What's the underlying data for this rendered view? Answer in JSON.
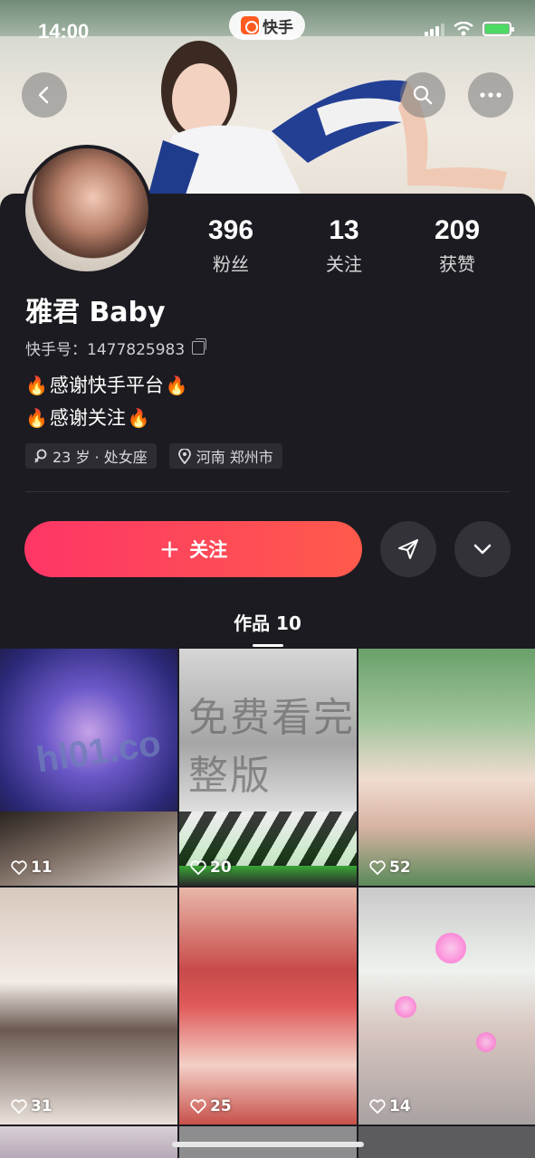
{
  "status_bar": {
    "time": "14:00",
    "app_badge_label": "快手",
    "icons": [
      "signal-icon",
      "wifi-icon",
      "battery-charging-icon"
    ]
  },
  "header": {
    "back_icon": "chevron-left-icon",
    "search_icon": "search-icon",
    "more_icon": "more-horizontal-icon"
  },
  "profile": {
    "stats": [
      {
        "value": "396",
        "label": "粉丝"
      },
      {
        "value": "13",
        "label": "关注"
      },
      {
        "value": "209",
        "label": "获赞"
      }
    ],
    "name": "雅君 Baby",
    "kuaishou_id_label": "快手号：",
    "kuaishou_id": "1477825983",
    "bio_lines": [
      "感谢快手平台",
      "感谢关注"
    ],
    "tags": [
      {
        "icon": "gender-female-icon",
        "text": "23 岁 · 处女座"
      },
      {
        "icon": "location-pin-icon",
        "text": "河南 郑州市"
      }
    ]
  },
  "actions": {
    "follow_plus": "+",
    "follow_label": "关注",
    "share_icon": "send-icon",
    "expand_icon": "chevron-down-icon"
  },
  "tabs": {
    "works_label": "作品 10"
  },
  "grid": {
    "watermark_1": "hl01.co",
    "watermark_2": "免费看完整版",
    "items": [
      {
        "likes": "11"
      },
      {
        "likes": "20"
      },
      {
        "likes": "52"
      },
      {
        "likes": "31"
      },
      {
        "likes": "25"
      },
      {
        "likes": "14"
      }
    ]
  },
  "colors": {
    "background": "#1c1b21",
    "follow_gradient_start": "#fe3666",
    "follow_gradient_end": "#ff5a4c",
    "brand_orange": "#ff5a1f"
  }
}
